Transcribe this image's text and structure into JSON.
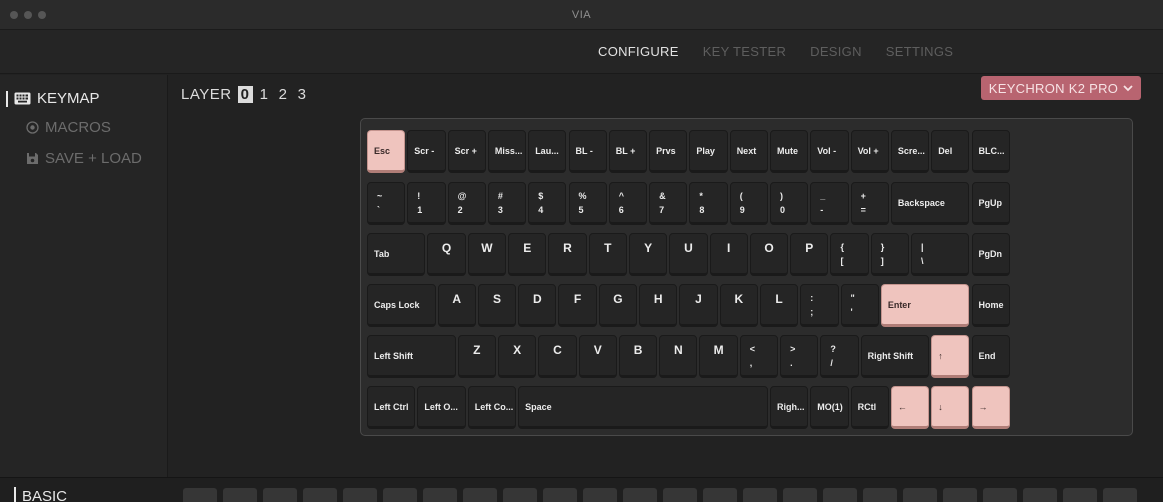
{
  "window": {
    "title": "VIA"
  },
  "nav": {
    "tabs": [
      "CONFIGURE",
      "KEY TESTER",
      "DESIGN",
      "SETTINGS"
    ],
    "active": 0
  },
  "sidebar": {
    "items": [
      {
        "label": "KEYMAP",
        "icon": "keyboard-icon",
        "active": true
      },
      {
        "label": "MACROS",
        "icon": "record-circle-icon",
        "active": false
      },
      {
        "label": "SAVE + LOAD",
        "icon": "floppy-disk-icon",
        "active": false
      }
    ]
  },
  "bottom": {
    "section_label": "BASIC"
  },
  "layer": {
    "label": "LAYER",
    "options": [
      "0",
      "1",
      "2",
      "3"
    ],
    "selected": "0"
  },
  "keyboard_selector": {
    "value": "KEYCHRON K2 PRO",
    "icon": "chevron-down-icon"
  },
  "colors": {
    "accent_key": "#efc4be",
    "selector": "#b86470",
    "background": "#222222"
  },
  "keys": {
    "row0": [
      "Esc",
      "Scr -",
      "Scr +",
      "Miss...",
      "Lau...",
      "BL -",
      "BL +",
      "Prvs",
      "Play",
      "Next",
      "Mute",
      "Vol -",
      "Vol +",
      "Scre...",
      "Del",
      "BLC..."
    ],
    "row1": [
      {
        "top": "~",
        "bot": "`"
      },
      {
        "top": "!",
        "bot": "1"
      },
      {
        "top": "@",
        "bot": "2"
      },
      {
        "top": "#",
        "bot": "3"
      },
      {
        "top": "$",
        "bot": "4"
      },
      {
        "top": "%",
        "bot": "5"
      },
      {
        "top": "^",
        "bot": "6"
      },
      {
        "top": "&",
        "bot": "7"
      },
      {
        "top": "*",
        "bot": "8"
      },
      {
        "top": "(",
        "bot": "9"
      },
      {
        "top": ")",
        "bot": "0"
      },
      {
        "top": "_",
        "bot": "-"
      },
      {
        "top": "+",
        "bot": "="
      },
      "Backspace",
      "PgUp"
    ],
    "row2": [
      "Tab",
      "Q",
      "W",
      "E",
      "R",
      "T",
      "Y",
      "U",
      "I",
      "O",
      "P",
      {
        "top": "{",
        "bot": "["
      },
      {
        "top": "}",
        "bot": "]"
      },
      {
        "top": "|",
        "bot": "\\"
      },
      "PgDn"
    ],
    "row3": [
      "Caps Lock",
      "A",
      "S",
      "D",
      "F",
      "G",
      "H",
      "J",
      "K",
      "L",
      {
        "top": ":",
        "bot": ";"
      },
      {
        "top": "\"",
        "bot": "'"
      },
      "Enter",
      "Home"
    ],
    "row4": [
      "Left Shift",
      "Z",
      "X",
      "C",
      "V",
      "B",
      "N",
      "M",
      {
        "top": "<",
        "bot": ","
      },
      {
        "top": ">",
        "bot": "."
      },
      {
        "top": "?",
        "bot": "/"
      },
      "Right Shift",
      "↑",
      "End"
    ],
    "row5": [
      "Left Ctrl",
      "Left O...",
      "Left Co...",
      "Space",
      "Righ...",
      "MO(1)",
      "RCtl",
      "←",
      "↓",
      "→"
    ]
  }
}
